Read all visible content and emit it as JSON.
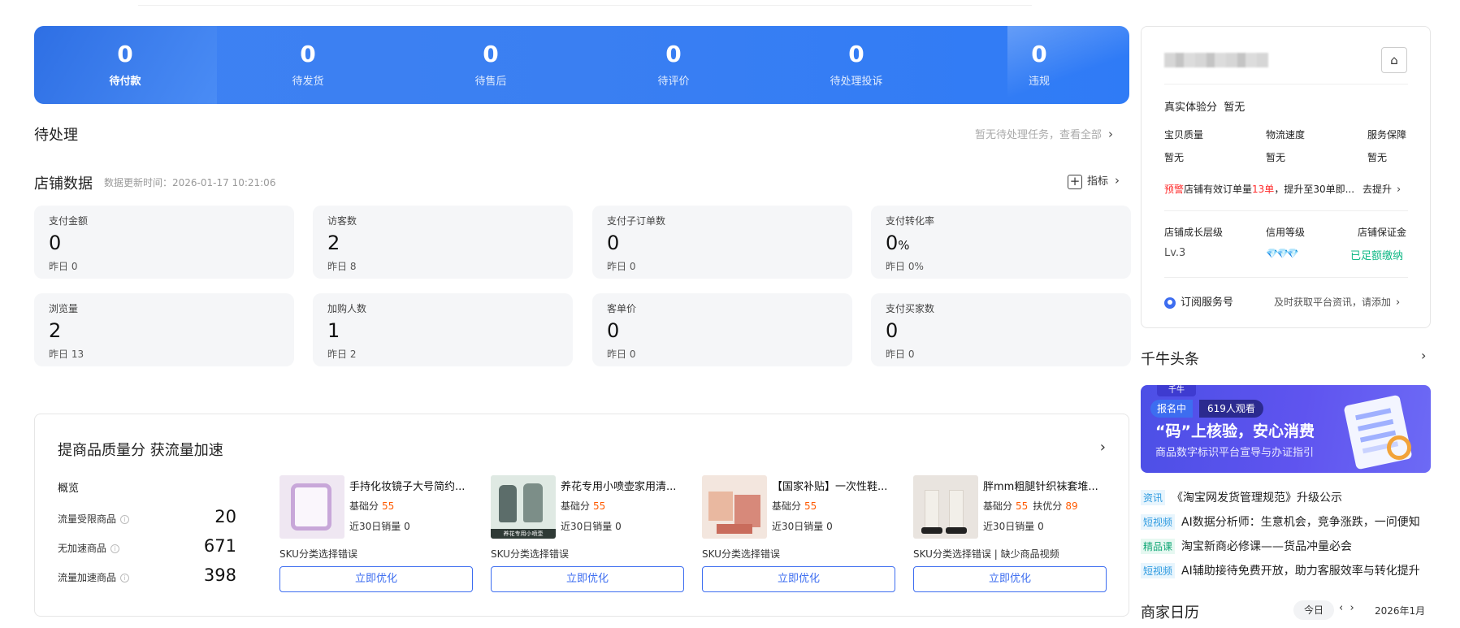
{
  "order_status": [
    {
      "count": "0",
      "label": "待付款"
    },
    {
      "count": "0",
      "label": "待发货"
    },
    {
      "count": "0",
      "label": "待售后"
    },
    {
      "count": "0",
      "label": "待评价"
    },
    {
      "count": "0",
      "label": "待处理投诉"
    },
    {
      "count": "0",
      "label": "违规"
    }
  ],
  "pending": {
    "title": "待处理",
    "link": "暂无待处理任务，查看全部"
  },
  "store_data": {
    "title": "店铺数据",
    "update_time": "数据更新时间：2026-01-17 10:21:06",
    "metrics_link": "指标",
    "metrics": [
      {
        "label": "支付金额",
        "value": "0",
        "unit": "",
        "yesterday": "昨日 0"
      },
      {
        "label": "访客数",
        "value": "2",
        "unit": "",
        "yesterday": "昨日 8"
      },
      {
        "label": "支付子订单数",
        "value": "0",
        "unit": "",
        "yesterday": "昨日 0"
      },
      {
        "label": "支付转化率",
        "value": "0",
        "unit": "%",
        "yesterday": "昨日 0%"
      },
      {
        "label": "浏览量",
        "value": "2",
        "unit": "",
        "yesterday": "昨日 13"
      },
      {
        "label": "加购人数",
        "value": "1",
        "unit": "",
        "yesterday": "昨日 2"
      },
      {
        "label": "客单价",
        "value": "0",
        "unit": "",
        "yesterday": "昨日 0"
      },
      {
        "label": "支付买家数",
        "value": "0",
        "unit": "",
        "yesterday": "昨日 0"
      }
    ]
  },
  "quality": {
    "title": "提商品质量分 获流量加速",
    "overview_title": "概览",
    "overview": [
      {
        "label": "流量受限商品",
        "value": "20"
      },
      {
        "label": "无加速商品",
        "value": "671"
      },
      {
        "label": "流量加速商品",
        "value": "398"
      }
    ],
    "products": [
      {
        "name": "手持化妆镜子大号简约...",
        "base_label": "基础分",
        "base_score": "55",
        "extra_label": "",
        "extra_score": "",
        "sales": "近30日销量 0",
        "issue": "SKU分类选择错误",
        "button": "立即优化",
        "image_color": "#efe7f2"
      },
      {
        "name": "养花专用小喷壶家用清...",
        "base_label": "基础分",
        "base_score": "55",
        "extra_label": "",
        "extra_score": "",
        "sales": "近30日销量 0",
        "issue": "SKU分类选择错误",
        "button": "立即优化",
        "image_color": "#dfe9e3"
      },
      {
        "name": "【国家补贴】一次性鞋...",
        "base_label": "基础分",
        "base_score": "55",
        "extra_label": "",
        "extra_score": "",
        "sales": "近30日销量 0",
        "issue": "SKU分类选择错误",
        "button": "立即优化",
        "image_color": "#f3e6de"
      },
      {
        "name": "胖mm粗腿针织袜套堆...",
        "base_label": "基础分",
        "base_score": "55",
        "extra_label": "扶优分",
        "extra_score": "89",
        "sales": "近30日销量 0",
        "issue": "SKU分类选择错误 | 缺少商品视频",
        "button": "立即优化",
        "image_color": "#e9e4df"
      }
    ]
  },
  "shop_card": {
    "experience_label": "真实体验分",
    "experience_value": "暂无",
    "scores": [
      {
        "label": "宝贝质量",
        "value": "暂无"
      },
      {
        "label": "物流速度",
        "value": "暂无"
      },
      {
        "label": "服务保障",
        "value": "暂无"
      }
    ],
    "warning_tag": "预警",
    "warning_pre": "店铺有效订单量",
    "warning_count": "13单",
    "warning_post": "，提升至30单即...",
    "warning_action": "去提升",
    "growth_label": "店铺成长层级",
    "growth_value": "Lv.3",
    "credit_label": "信用等级",
    "credit_value": "💎💎💎",
    "deposit_label": "店铺保证金",
    "deposit_value": "已足额缴纳",
    "subscribe_label": "订阅服务号",
    "subscribe_hint": "及时获取平台资讯，请添加"
  },
  "news": {
    "title": "千牛头条",
    "banner": {
      "flag": "千牛",
      "tag": "报名中",
      "viewers": "619人观看",
      "headline": "“码”上核验，安心消费",
      "subline": "商品数字标识平台宣导与办证指引"
    },
    "items": [
      {
        "tag": "资讯",
        "text": "《淘宝网发货管理规范》升级公示"
      },
      {
        "tag": "短视频",
        "text": "AI数据分析师：生意机会，竞争涨跌，一问便知"
      },
      {
        "tag": "精品课",
        "text": "淘宝新商必修课——货品冲量必会"
      },
      {
        "tag": "短视频",
        "text": "AI辅助接待免费开放，助力客服效率与转化提升"
      }
    ]
  },
  "calendar": {
    "title": "商家日历",
    "today": "今日",
    "month": "2026年1月"
  }
}
